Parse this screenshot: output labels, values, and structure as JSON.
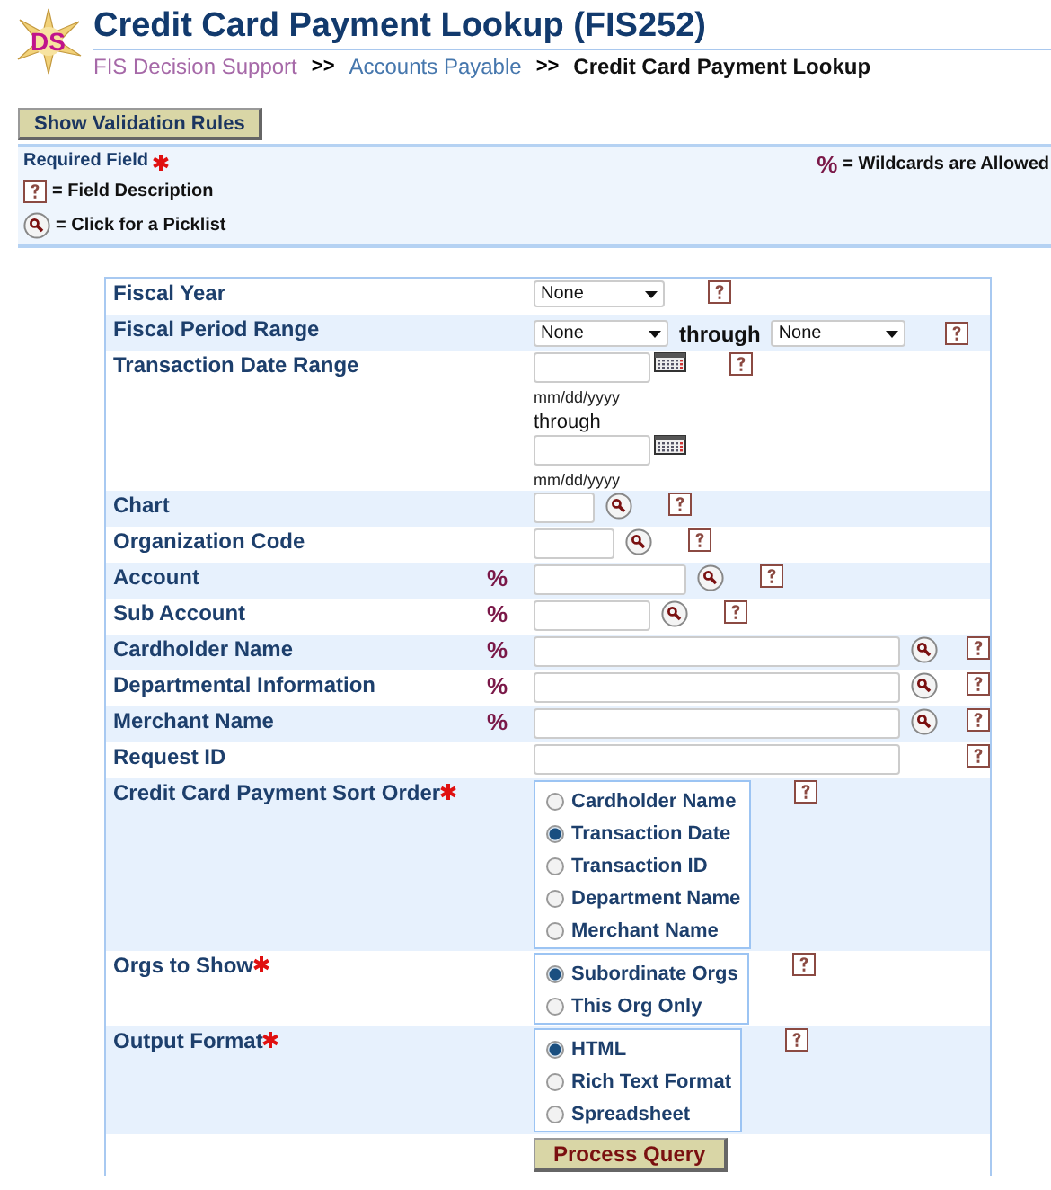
{
  "header": {
    "logo_text": "DS",
    "title": "Credit Card Payment Lookup (FIS252)",
    "breadcrumb": [
      {
        "label": "FIS Decision Support",
        "kind": "link",
        "visited": true
      },
      {
        "label": "Accounts Payable",
        "kind": "link",
        "visited": false
      },
      {
        "label": "Credit Card Payment Lookup",
        "kind": "current"
      }
    ],
    "separator": ">>"
  },
  "validation_button": "Show Validation Rules",
  "legend": {
    "required": "Required Field",
    "wildcard_symbol": "%",
    "wildcard": "= Wildcards are Allowed",
    "help": "= Field Description",
    "picklist": "= Click for a Picklist"
  },
  "rows": [
    {
      "kind": "select",
      "label": "Fiscal Year",
      "required": false,
      "value": "None"
    },
    {
      "kind": "select_range",
      "label": "Fiscal Period Range",
      "required": false,
      "value": "None",
      "through": "through",
      "value2": "None"
    },
    {
      "kind": "date_range",
      "label": "Transaction Date Range",
      "required": false,
      "hint": "mm/dd/yyyy",
      "through": "through",
      "hint2": "mm/dd/yyyy"
    },
    {
      "kind": "short_text",
      "label": "Chart",
      "required": false,
      "picklist": true
    },
    {
      "kind": "short_text",
      "label": "Organization Code",
      "required": false,
      "picklist": true
    },
    {
      "kind": "short_text",
      "label": "Account",
      "required": false,
      "wildcard": "%",
      "picklist": true
    },
    {
      "kind": "short_text",
      "label": "Sub Account",
      "required": false,
      "wildcard": "%",
      "picklist": true
    },
    {
      "kind": "long_text",
      "label": "Cardholder Name",
      "required": false,
      "wildcard": "%",
      "picklist": true
    },
    {
      "kind": "long_text",
      "label": "Departmental Information",
      "required": false,
      "wildcard": "%",
      "picklist": true
    },
    {
      "kind": "long_text",
      "label": "Merchant Name",
      "required": false,
      "wildcard": "%",
      "picklist": true
    },
    {
      "kind": "long_text",
      "label": "Request ID",
      "required": false,
      "picklist": false
    },
    {
      "kind": "radio",
      "label": "Credit Card Payment Sort Order",
      "required": true,
      "options": [
        {
          "label": "Cardholder Name",
          "selected": false
        },
        {
          "label": "Transaction Date",
          "selected": true
        },
        {
          "label": "Transaction ID",
          "selected": false
        },
        {
          "label": "Department Name",
          "selected": false
        },
        {
          "label": "Merchant Name",
          "selected": false
        }
      ]
    },
    {
      "kind": "radio",
      "label": "Orgs to Show",
      "required": true,
      "options": [
        {
          "label": "Subordinate Orgs",
          "selected": true
        },
        {
          "label": "This Org Only",
          "selected": false
        }
      ]
    },
    {
      "kind": "radio",
      "label": "Output Format",
      "required": true,
      "options": [
        {
          "label": "HTML",
          "selected": true
        },
        {
          "label": "Rich Text Format",
          "selected": false
        },
        {
          "label": "Spreadsheet",
          "selected": false
        }
      ]
    }
  ],
  "submit": "Process Query"
}
